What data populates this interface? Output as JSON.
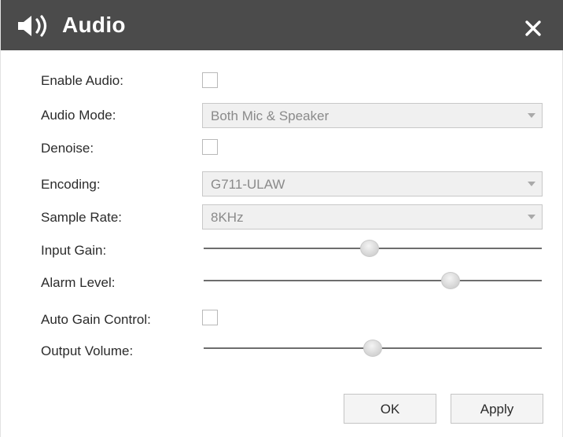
{
  "dialog": {
    "title": "Audio",
    "title_icon": "speaker-icon",
    "close_icon": "close-icon"
  },
  "fields": {
    "enable_audio": {
      "label": "Enable Audio:",
      "checked": false
    },
    "audio_mode": {
      "label": "Audio Mode:",
      "value": "Both Mic & Speaker"
    },
    "denoise": {
      "label": "Denoise:",
      "checked": false
    },
    "encoding": {
      "label": "Encoding:",
      "value": "G711-ULAW"
    },
    "sample_rate": {
      "label": "Sample Rate:",
      "value": "8KHz"
    },
    "input_gain": {
      "label": "Input Gain:",
      "level": 0.49
    },
    "alarm_level": {
      "label": "Alarm Level:",
      "level": 0.73
    },
    "auto_gain_control": {
      "label": "Auto Gain Control:",
      "checked": false
    },
    "output_volume": {
      "label": "Output Volume:",
      "level": 0.5
    }
  },
  "buttons": {
    "ok": "OK",
    "apply": "Apply"
  },
  "colors": {
    "titlebar": "#4b4b4b",
    "select_background": "#f0f0f0",
    "slider_track": "#6d6d6d"
  }
}
